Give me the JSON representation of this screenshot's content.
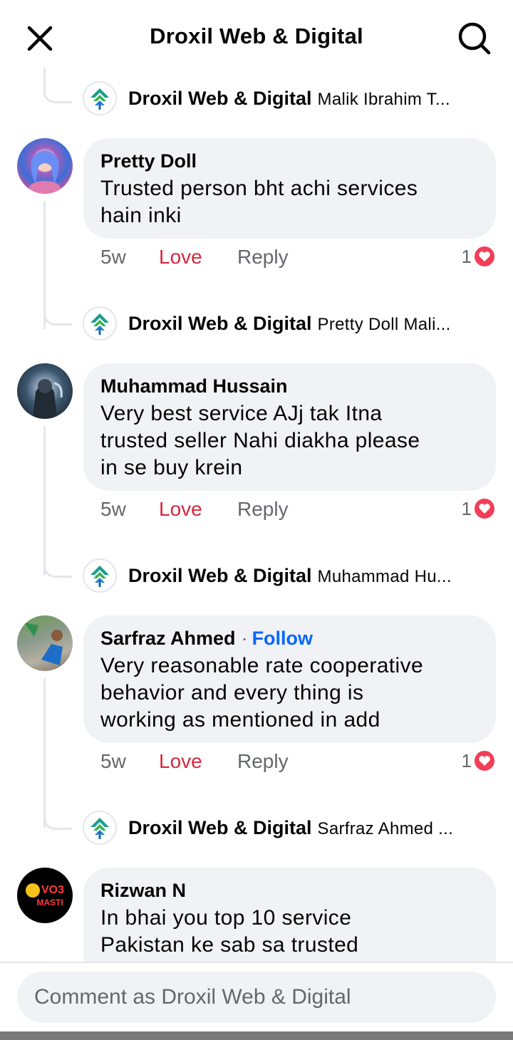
{
  "header": {
    "title": "Droxil Web & Digital"
  },
  "replies": [
    {
      "author": "Droxil Web & Digital",
      "snippet": "Malik Ibrahim T..."
    },
    {
      "author": "Droxil Web & Digital",
      "snippet": "Pretty Doll Mali..."
    },
    {
      "author": "Droxil Web & Digital",
      "snippet": "Muhammad Hu..."
    },
    {
      "author": "Droxil Web & Digital",
      "snippet": "Sarfraz Ahmed ..."
    }
  ],
  "comments": [
    {
      "author": "Pretty Doll",
      "lines": [
        "Trusted person bht achi services",
        "hain inki"
      ],
      "time": "5w",
      "love_label": "Love",
      "reply_label": "Reply",
      "reaction_count": "1"
    },
    {
      "author": "Muhammad Hussain",
      "lines": [
        "Very best service AJj tak Itna",
        "trusted seller Nahi diakha please",
        "in se buy krein"
      ],
      "time": "5w",
      "love_label": "Love",
      "reply_label": "Reply",
      "reaction_count": "1"
    },
    {
      "author": "Sarfraz Ahmed",
      "follow_separator": "·",
      "follow_label": "Follow",
      "lines": [
        "Very reasonable rate cooperative",
        "behavior and every thing is",
        "working as mentioned in add"
      ],
      "time": "5w",
      "love_label": "Love",
      "reply_label": "Reply",
      "reaction_count": "1"
    },
    {
      "author": "Rizwan N",
      "lines": [
        "In bhai you top 10 service",
        "Pakistan ke sab sa trusted"
      ],
      "avatar_text": [
        "VO3",
        "MASTI"
      ]
    }
  ],
  "composer": {
    "placeholder": "Comment as Droxil Web & Digital"
  },
  "colors": {
    "love": "#d7263d",
    "follow": "#0866ff",
    "heart": "#f33e58",
    "bubble": "#f0f2f5"
  },
  "icons": {
    "close": "close-icon",
    "search": "search-icon",
    "heart": "heart-icon"
  }
}
